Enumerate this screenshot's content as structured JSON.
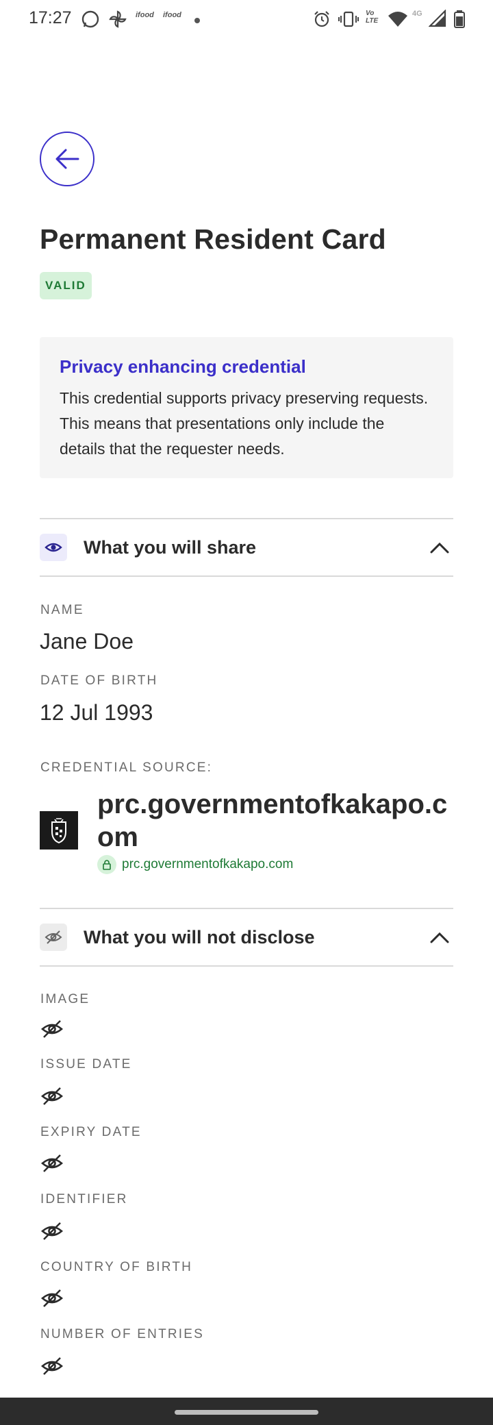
{
  "status_bar": {
    "time": "17:27",
    "left_icons": [
      "whatsapp-icon",
      "pinwheel-icon",
      "ifood-icon",
      "ifood-icon",
      "dot-icon"
    ],
    "ifood_label": "ifood",
    "right_icons": [
      "alarm-icon",
      "vibrate-icon",
      "volte-icon",
      "wifi-icon",
      "signal-icon",
      "battery-icon"
    ],
    "volte_label": "Vo LTE",
    "network_label": "4G"
  },
  "page": {
    "title": "Permanent Resident Card",
    "status": "VALID"
  },
  "info": {
    "title": "Privacy enhancing credential",
    "body": "This credential supports privacy preserving requests. This means that presentations only include the details that the requester needs."
  },
  "share_section": {
    "title": "What you will share",
    "fields": [
      {
        "label": "NAME",
        "value": "Jane  Doe"
      },
      {
        "label": "DATE OF BIRTH",
        "value": "12 Jul 1993"
      }
    ]
  },
  "source": {
    "label": "CREDENTIAL SOURCE:",
    "domain": "prc.governmentofkakapo.com",
    "secure_domain": "prc.governmentofkakapo.com"
  },
  "not_disclose_section": {
    "title": "What you will not disclose",
    "fields": [
      {
        "label": "IMAGE"
      },
      {
        "label": "ISSUE DATE"
      },
      {
        "label": "EXPIRY DATE"
      },
      {
        "label": "IDENTIFIER"
      },
      {
        "label": "COUNTRY OF BIRTH"
      },
      {
        "label": "NUMBER OF ENTRIES"
      }
    ]
  },
  "colors": {
    "accent": "#3b2fc9",
    "valid_bg": "#d6f2da",
    "valid_text": "#1e7a35",
    "info_bg": "#f5f5f5"
  }
}
